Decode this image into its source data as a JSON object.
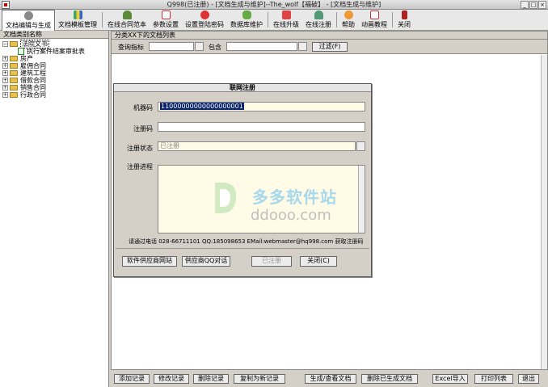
{
  "window": {
    "title": "Q998(已注册) - [文档生成与维护]--The_wolf【福破】 - [文档生成与维护]",
    "minimize": "_",
    "maximize": "□",
    "close": "×"
  },
  "toolbar": {
    "items": [
      {
        "label": "文档编辑与生成",
        "icon": "gear-icon"
      },
      {
        "label": "文档模板管理",
        "icon": "chart-icon"
      },
      {
        "label": "在线合同范本",
        "icon": "person-icon"
      },
      {
        "label": "参数设置",
        "icon": "calendar-icon"
      },
      {
        "label": "设置登陆密码",
        "icon": "key-icon"
      },
      {
        "label": "数据库维护",
        "icon": "people-icon"
      },
      {
        "label": "在线升级",
        "icon": "upgrade-icon"
      },
      {
        "label": "在线注册",
        "icon": "register-icon"
      },
      {
        "label": "帮助",
        "icon": "help-icon"
      },
      {
        "label": "动画教程",
        "icon": "tutorial-icon"
      },
      {
        "label": "关闭",
        "icon": "close-icon"
      }
    ]
  },
  "left_panel": {
    "title": "文档类别名称",
    "tree": [
      {
        "label": "法院文书",
        "expander": "−",
        "selected": true
      },
      {
        "label": "执行案件结案审批表",
        "child": true
      },
      {
        "label": "房产",
        "expander": "+"
      },
      {
        "label": "雇佣合同",
        "expander": "+"
      },
      {
        "label": "建筑工程",
        "expander": "+"
      },
      {
        "label": "借款合同",
        "expander": "+"
      },
      {
        "label": "销售合同",
        "expander": "+"
      },
      {
        "label": "行政合同",
        "expander": "+"
      }
    ]
  },
  "right_panel": {
    "title": "分类XX下的文档列表",
    "query_label": "查询指标",
    "contains_label": "包含",
    "filter_button": "过滤(F)"
  },
  "bottom_buttons": {
    "add": "添加记录",
    "edit": "修改记录",
    "delete": "删除记录",
    "copy": "复制为新记录",
    "generate": "生成/查看文档",
    "delete_generated": "删除已生成文档",
    "excel_import": "Excel导入",
    "print_list": "打印列表",
    "exit": "退出"
  },
  "dialog": {
    "title": "联网注册",
    "machine_code_label": "机器码",
    "machine_code_value": "11000000000000000001",
    "reg_code_label": "注册码",
    "reg_code_value": "",
    "status_label": "注册状态",
    "status_value": "已注册",
    "progress_label": "注册进程",
    "contact_text": "请通过电话 028-66711101 QQ:185098653 EMail:webmaster@hq998.com 获取注册码",
    "btn_vendor_site": "软件供应商网站",
    "btn_vendor_qq": "供应商QQ对话",
    "btn_registered": "已注册",
    "btn_close": "关闭(C)"
  },
  "watermark": {
    "cn": "多多软件站",
    "en": "ddooo.com"
  }
}
